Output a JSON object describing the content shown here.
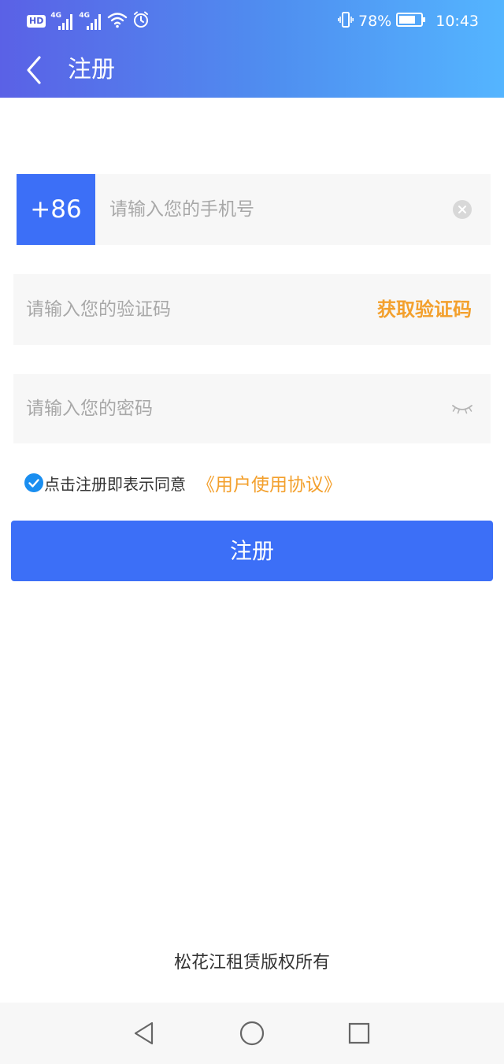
{
  "status_bar": {
    "hd": "HD",
    "network1": "4G",
    "network2": "4G",
    "battery": "78%",
    "time": "10:43",
    "icons": [
      "hd-icon",
      "signal-icon",
      "signal-icon",
      "wifi-icon",
      "alarm-icon",
      "vibrate-icon",
      "battery-icon"
    ]
  },
  "nav": {
    "back_icon": "chevron-left-icon",
    "title": "注册"
  },
  "form": {
    "country_code": "+86",
    "phone_placeholder": "请输入您的手机号",
    "code_placeholder": "请输入您的验证码",
    "get_code": "获取验证码",
    "password_placeholder": "请输入您的密码",
    "clear_icon": "clear-icon",
    "password_toggle_icon": "eye-closed-icon"
  },
  "agreement": {
    "checked": true,
    "text": "点击注册即表示同意",
    "link": "《用户使用协议》"
  },
  "submit_label": "注册",
  "footer": {
    "copyright": "松花江租赁版权所有"
  },
  "system_nav": {
    "back": "triangle-back-icon",
    "home": "circle-home-icon",
    "recents": "square-recents-icon"
  },
  "colors": {
    "primary": "#3c6ff7",
    "accent": "#f3a02d",
    "header_gradient_start": "#5a61e6",
    "header_gradient_end": "#54b5ff",
    "field_background": "#f7f7f7"
  }
}
